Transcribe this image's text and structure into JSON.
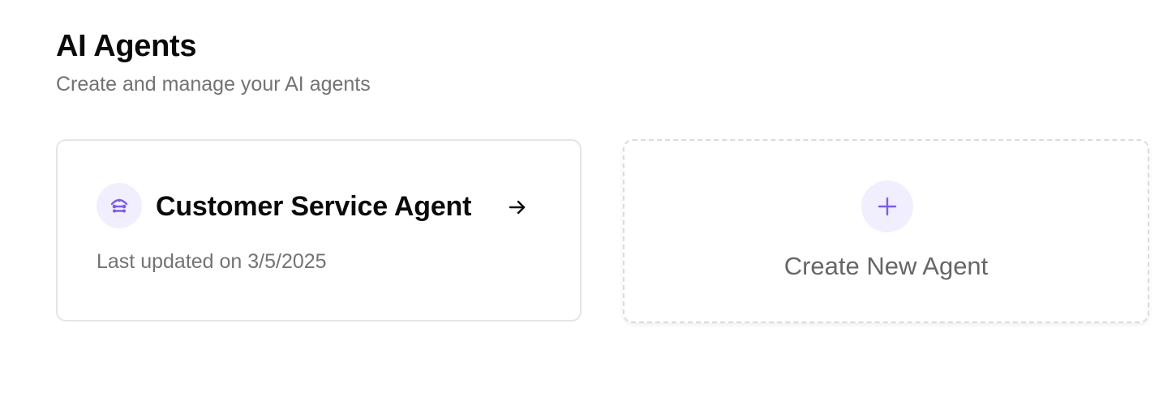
{
  "header": {
    "title": "AI Agents",
    "subtitle": "Create and manage your AI agents"
  },
  "agents": [
    {
      "name": "Customer Service Agent",
      "updated": "Last updated on 3/5/2025",
      "icon": "bot-icon",
      "action_icon": "arrow-right-icon"
    }
  ],
  "create_card": {
    "label": "Create New Agent",
    "icon": "plus-icon"
  },
  "colors": {
    "accent": "#7c5ce6",
    "accent_bg": "#f1eefe",
    "title": "#0a0a0a",
    "muted": "#737373",
    "border": "#e5e5e5"
  }
}
